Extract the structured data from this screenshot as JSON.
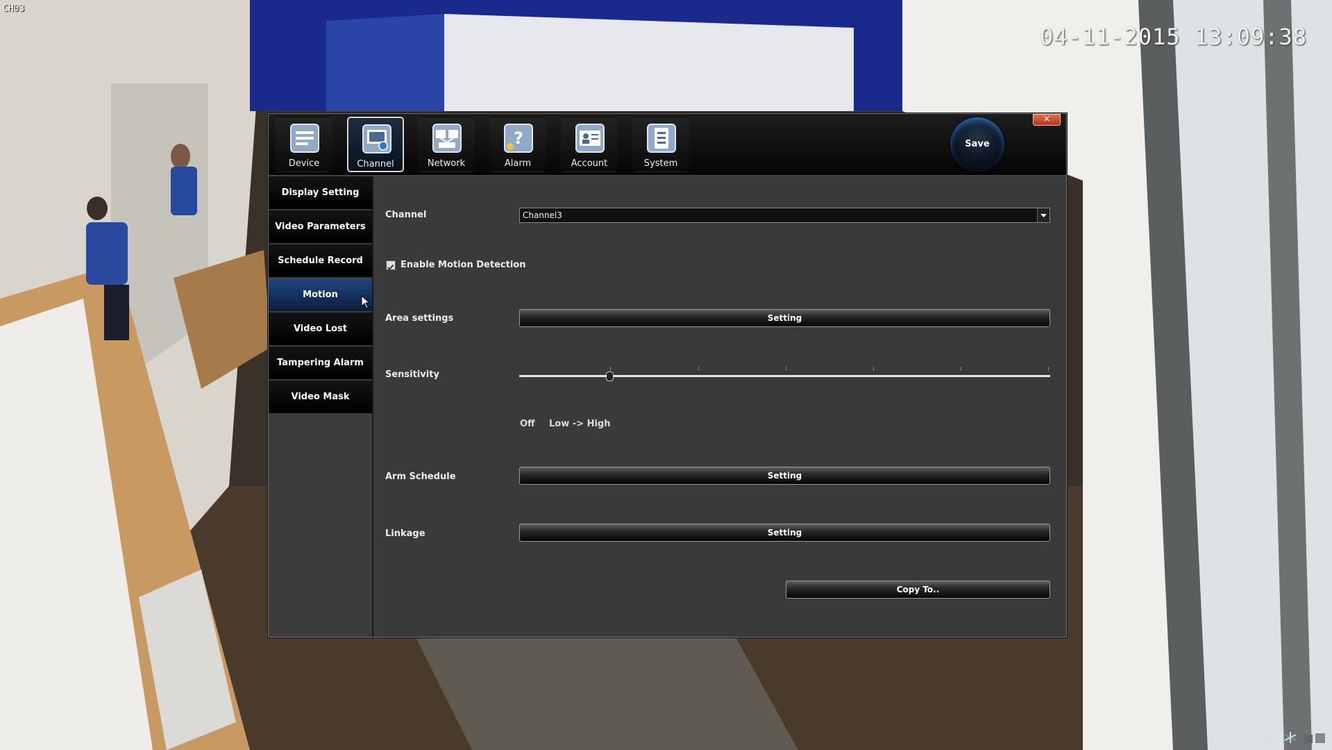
{
  "osd": {
    "channel": "CH03",
    "datetime": "04-11-2015 13:09:38"
  },
  "dialog": {
    "close_label": "×",
    "tabs": [
      {
        "label": "Device",
        "icon": "device-icon"
      },
      {
        "label": "Channel",
        "icon": "channel-icon"
      },
      {
        "label": "Network",
        "icon": "network-icon"
      },
      {
        "label": "Alarm",
        "icon": "alarm-icon"
      },
      {
        "label": "Account",
        "icon": "account-icon"
      },
      {
        "label": "System",
        "icon": "system-icon"
      }
    ],
    "active_tab": "Channel",
    "save_label": "Save",
    "sidebar": [
      {
        "label": "Display Setting"
      },
      {
        "label": "Video Parameters"
      },
      {
        "label": "Schedule Record"
      },
      {
        "label": "Motion"
      },
      {
        "label": "Video Lost"
      },
      {
        "label": "Tampering Alarm"
      },
      {
        "label": "Video Mask"
      }
    ],
    "active_sidebar": "Motion",
    "form": {
      "channel_label": "Channel",
      "channel_value": "Channel3",
      "enable_motion_label": "Enable Motion Detection",
      "enable_motion_checked": true,
      "area_label": "Area settings",
      "area_button": "Setting",
      "sensitivity_label": "Sensitivity",
      "sensitivity_fraction": 0.17,
      "scale_off": "Off",
      "scale_range": "Low -> High",
      "arm_label": "Arm Schedule",
      "arm_button": "Setting",
      "linkage_label": "Linkage",
      "linkage_button": "Setting",
      "copy_button": "Copy To.."
    }
  },
  "colors": {
    "active_tab_border": "#d6d6d6",
    "active_sidebar": "#1a3e78",
    "osd_text": "#f2f2f2"
  }
}
